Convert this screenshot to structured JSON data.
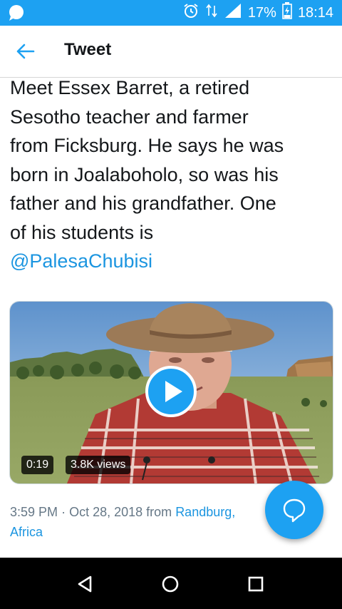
{
  "status_bar": {
    "background": "#1da1f2",
    "left_icon": "message-bubble-icon",
    "icons": [
      "alarm-icon",
      "data-arrows-icon",
      "signal-icon"
    ],
    "battery_percent": "17%",
    "battery_icon": "battery-charging-icon",
    "time": "18:14"
  },
  "header": {
    "back_icon": "arrow-left-icon",
    "title": "Tweet"
  },
  "tweet": {
    "text_lines": [
      "Meet Essex Barret, a retired",
      "Sesotho teacher and farmer",
      "from Ficksburg. He says he was",
      "born in Joalaboholo, so was his",
      "father and his grandfather. One",
      "of his students is"
    ],
    "mention": "@PalesaChubisi",
    "video": {
      "play_icon": "play-icon",
      "duration": "0:19",
      "views": "3.8K views"
    },
    "meta": {
      "time": "3:59 PM",
      "separator": "·",
      "date": "Oct 28, 2018",
      "from_label": "from",
      "location_line1": "Randburg,",
      "location_line2": "Africa"
    }
  },
  "fab": {
    "icon": "reply-bubble-icon"
  },
  "nav_bar": {
    "back_icon": "triangle-back-icon",
    "home_icon": "circle-home-icon",
    "recents_icon": "square-recents-icon"
  },
  "colors": {
    "accent": "#1da1f2",
    "link": "#1b95e0",
    "text": "#14171a",
    "meta_text": "#657786"
  }
}
